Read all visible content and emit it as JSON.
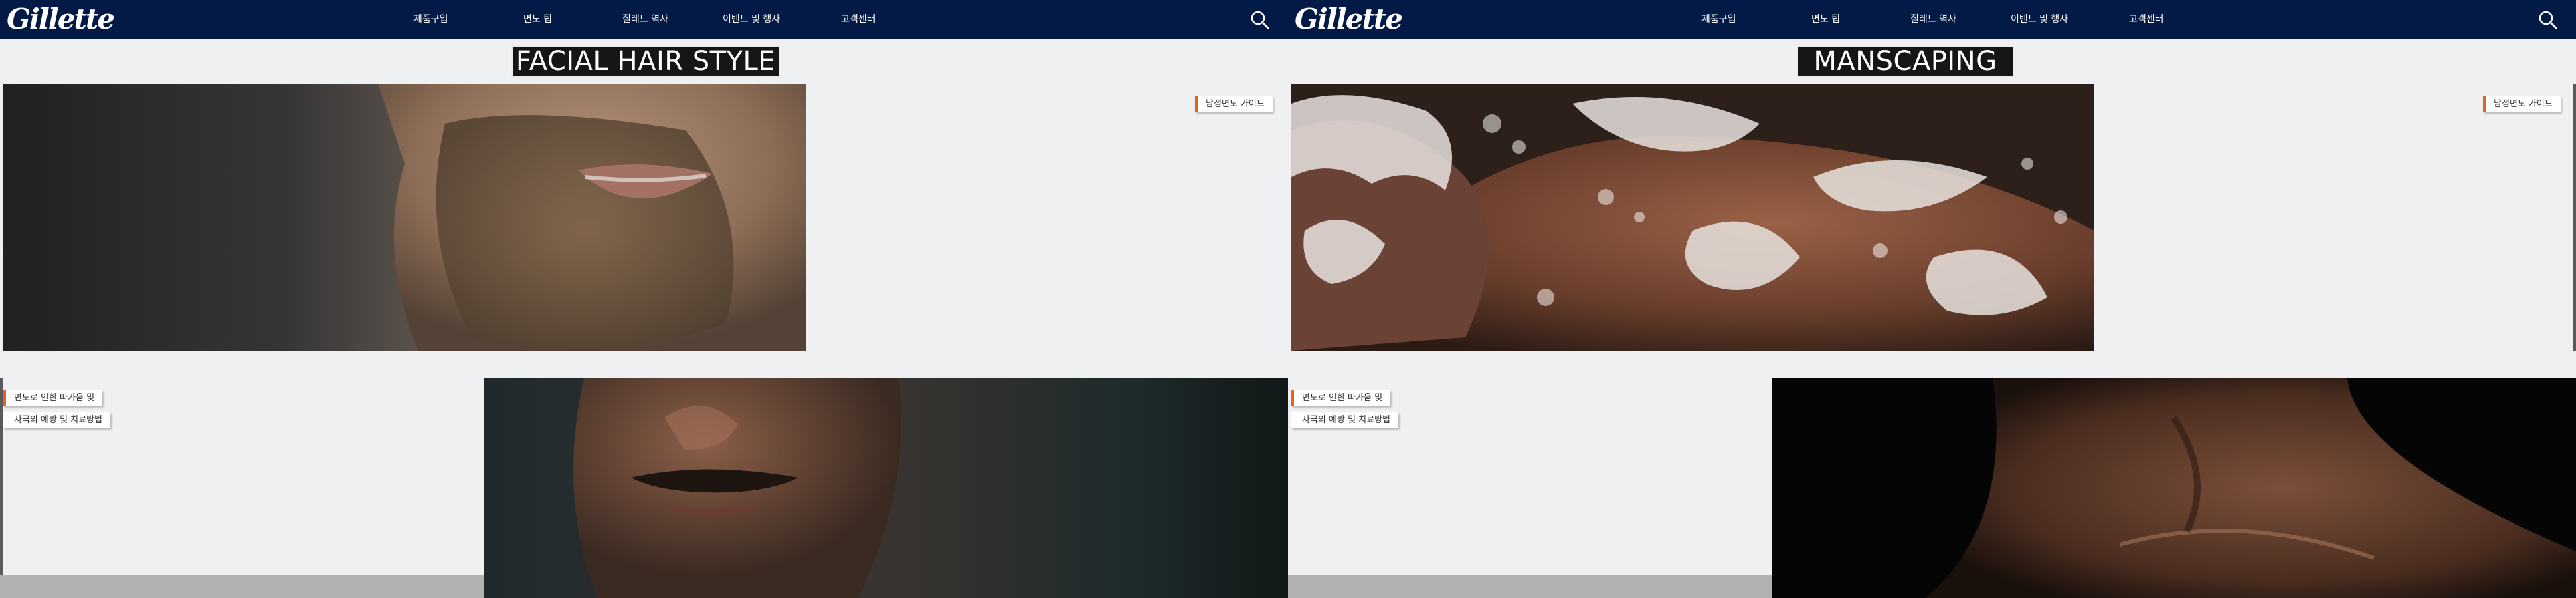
{
  "panels": [
    {
      "nav": {
        "logo": "Gillette",
        "items": [
          "제품구입",
          "면도 팁",
          "질레트 역사",
          "이벤트 및 행사",
          "고객센터"
        ]
      },
      "title": "FACIAL HAIR STYLE",
      "tag_guide": "남성면도 가이드",
      "tag_prevent_1": "면도로 인한 따가움 및",
      "tag_prevent_2": "자극의 예방 및 치료방법"
    },
    {
      "nav": {
        "logo": "Gillette",
        "items": [
          "제품구입",
          "면도 팁",
          "질레트 역사",
          "이벤트 및 행사",
          "고객센터"
        ]
      },
      "title": "MANSCAPING",
      "tag_guide": "남성면도 가이드",
      "tag_prevent_1": "면도로 인한 따가움 및",
      "tag_prevent_2": "자극의 예방 및 치료방법"
    }
  ],
  "colors": {
    "nav_bg": "#021a45",
    "accent": "#e0661e",
    "page_bg": "#eff0f2"
  },
  "icons": {
    "search": "search-icon"
  }
}
